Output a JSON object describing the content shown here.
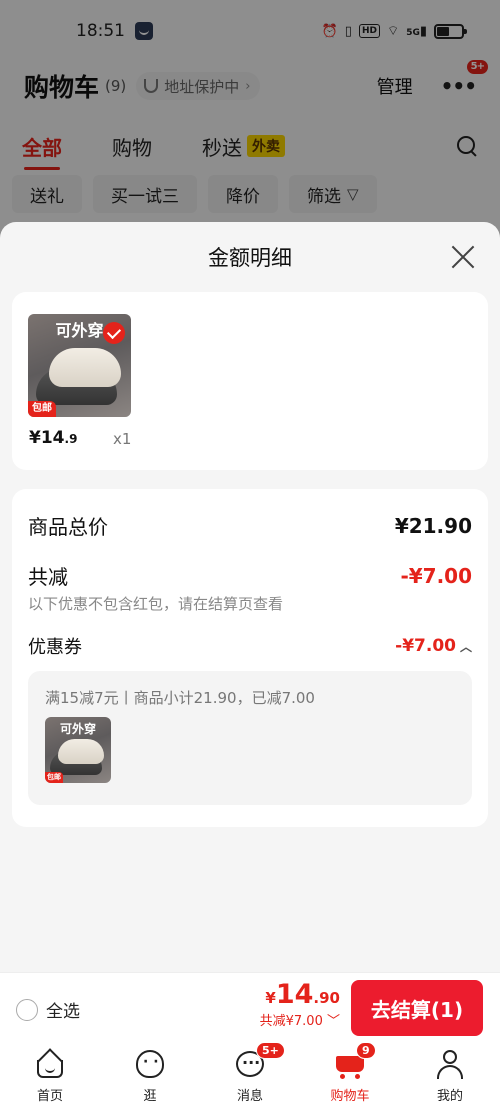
{
  "status_bar": {
    "time": "18:51",
    "network": "5G",
    "hd": "HD"
  },
  "header": {
    "title": "购物车",
    "count": "(9)",
    "address_chip": "地址保护中",
    "manage": "管理",
    "more_badge": "5+"
  },
  "tabs": [
    {
      "label": "全部",
      "active": true
    },
    {
      "label": "购物"
    },
    {
      "label": "秒送",
      "badge": "外卖"
    }
  ],
  "filters": [
    "送礼",
    "买一试三",
    "降价",
    "筛选"
  ],
  "sheet": {
    "title": "金额明细",
    "item": {
      "thumb_text": "可外穿",
      "thumb_tag": "包邮",
      "price_symbol": "¥",
      "price_int": "14",
      "price_dec": ".9",
      "qty": "x1"
    },
    "summary": {
      "total_label": "商品总价",
      "total_value": "¥21.90",
      "reduce_label": "共减",
      "reduce_value": "-¥7.00",
      "reduce_note": "以下优惠不包含红包，请在结算页查看",
      "coupon_label": "优惠券",
      "coupon_value": "-¥7.00",
      "coupon_desc": "满15减7元丨商品小计21.90，已减7.00",
      "coupon_thumb_text": "可外穿",
      "coupon_thumb_tag": "包邮"
    }
  },
  "checkout": {
    "select_all": "全选",
    "price_symbol": "¥",
    "price_int": "14",
    "price_dec": ".90",
    "discount": "共减¥7.00",
    "pay_button": "去结算(1)"
  },
  "bottom_nav": [
    {
      "label": "首页",
      "icon": "home-icon"
    },
    {
      "label": "逛",
      "icon": "explore-icon"
    },
    {
      "label": "消息",
      "icon": "message-icon",
      "badge": "5+"
    },
    {
      "label": "购物车",
      "icon": "cart-icon",
      "badge": "9",
      "active": true
    },
    {
      "label": "我的",
      "icon": "profile-icon"
    }
  ],
  "colors": {
    "accent": "#e4231b",
    "pay_button": "#ec1c2e",
    "tab_badge": "#f7d200"
  }
}
